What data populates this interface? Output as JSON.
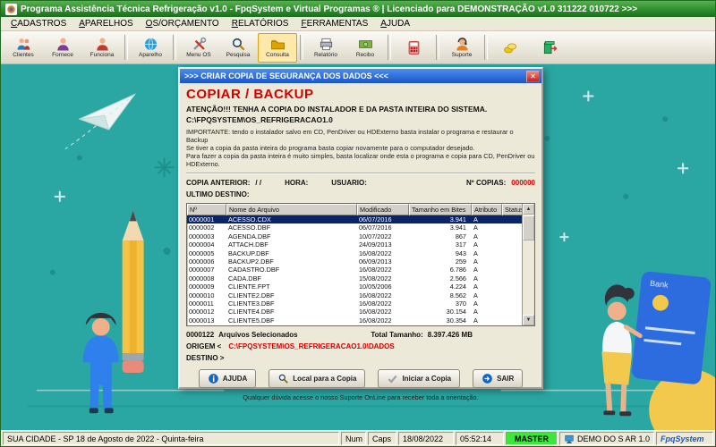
{
  "window": {
    "title": "Programa Assistência Técnica Refrigeração v1.0 - FpqSystem e Virtual Programas ® | Licenciado para  DEMONSTRAÇÃO v1.0 311222 010722 >>>"
  },
  "menu": {
    "items": [
      "CADASTROS",
      "APARELHOS",
      "OS/ORÇAMENTO",
      "RELATÓRIOS",
      "FERRAMENTAS",
      "AJUDA"
    ]
  },
  "toolbar": {
    "buttons": [
      {
        "label": "Clientes",
        "icon": "clients-icon"
      },
      {
        "label": "Fornece",
        "icon": "supplier-icon"
      },
      {
        "label": "Funciona",
        "icon": "employee-icon",
        "sep_after": true
      },
      {
        "label": "Aparelho",
        "icon": "device-globe-icon",
        "sep_after": true
      },
      {
        "label": "Menu OS",
        "icon": "tools-icon"
      },
      {
        "label": "Pesquisa",
        "icon": "search-icon"
      },
      {
        "label": "Consulta",
        "icon": "folder-icon",
        "highlighted": true,
        "sep_after": true
      },
      {
        "label": "Relatório",
        "icon": "printer-icon"
      },
      {
        "label": "Recibo",
        "icon": "money-icon",
        "sep_after": true
      },
      {
        "label": "",
        "icon": "calculator-icon",
        "sep_after": true
      },
      {
        "label": "Suporte",
        "icon": "support-icon",
        "sep_after": true
      },
      {
        "label": "",
        "icon": "coins-icon"
      },
      {
        "label": "",
        "icon": "exit-door-icon"
      }
    ]
  },
  "dialog": {
    "title": ">>> CRIAR COPIA DE SEGURANÇA DOS DADOS <<<",
    "close_glyph": "✕",
    "heading": "COPIAR / BACKUP",
    "warning": "ATENÇÃO!!!  TENHA A COPIA DO  INSTALADOR  E DA PASTA INTEIRA DO  SISTEMA.",
    "system_path": "C:\\FPQSYSTEM\\OS_REFRIGERACAO1.0",
    "important_lines": [
      "IMPORTANTE: tendo o instalador salvo em CD, PenDriver ou HDExterno basta instalar o programa e restaurar o Backup",
      "Se tiver a copia da pasta inteira do programa basta copiar novamente para o computador desejado.",
      "Para fazer a copia da pasta inteira é muito simples, basta localizar onde esta o programa e copia para CD, PenDriver ou HDExterno."
    ],
    "fields": {
      "copia_anterior_label": "COPIA ANTERIOR:",
      "copia_anterior_value": "/ /",
      "hora_label": "HORA:",
      "usuario_label": "USUARIO:",
      "n_copias_label": "Nº COPIAS:",
      "n_copias_value": "000000",
      "ultimo_destino_label": "ULTIMO DESTINO:"
    },
    "table": {
      "columns": [
        "Nº",
        "Nome do Arquivo",
        "Modificado",
        "Tamanho em Bites",
        "Atributo",
        "Status"
      ],
      "selected_index": 0,
      "rows": [
        [
          "0000001",
          "ACESSO.CDX",
          "06/07/2016",
          "3.941",
          "A",
          ""
        ],
        [
          "0000002",
          "ACESSO.DBF",
          "06/07/2016",
          "3.941",
          "A",
          ""
        ],
        [
          "0000003",
          "AGENDA.DBF",
          "10/07/2022",
          "867",
          "A",
          ""
        ],
        [
          "0000004",
          "ATTACH.DBF",
          "24/09/2013",
          "317",
          "A",
          ""
        ],
        [
          "0000005",
          "BACKUP.DBF",
          "16/08/2022",
          "943",
          "A",
          ""
        ],
        [
          "0000006",
          "BACKUP2.DBF",
          "06/09/2013",
          "259",
          "A",
          ""
        ],
        [
          "0000007",
          "CADASTRO.DBF",
          "16/08/2022",
          "6.786",
          "A",
          ""
        ],
        [
          "0000008",
          "CADA.DBF",
          "15/08/2022",
          "2.566",
          "A",
          ""
        ],
        [
          "0000009",
          "CLIENTE.FPT",
          "10/05/2006",
          "4.224",
          "A",
          ""
        ],
        [
          "0000010",
          "CLIENTE2.DBF",
          "16/08/2022",
          "8.562",
          "A",
          ""
        ],
        [
          "0000011",
          "CLIENTE3.DBF",
          "16/08/2022",
          "370",
          "A",
          ""
        ],
        [
          "0000012",
          "CLIENTE4.DBF",
          "16/08/2022",
          "30.154",
          "A",
          ""
        ],
        [
          "0000013",
          "CLIENTE5.DBF",
          "16/08/2022",
          "30.354",
          "A",
          ""
        ]
      ]
    },
    "scrollbar": {
      "up": "▲",
      "down": "▼"
    },
    "summary": {
      "count": "0000122",
      "count_label": "Arquivos Selecionados",
      "total_label": "Total Tamanho:",
      "total_value": "8.397.426 MB"
    },
    "origem_label": "ORIGEM  <",
    "origem_path": "C:\\FPQSYSTEM\\OS_REFRIGERACAO1.0\\DADOS",
    "destino_label": "DESTINO >",
    "buttons": [
      {
        "label": "AJUDA",
        "icon": "help-icon"
      },
      {
        "label": "Local para a Copia",
        "icon": "magnifier-icon"
      },
      {
        "label": "Iniciar a Copia",
        "icon": "check-icon"
      },
      {
        "label": "SAIR",
        "icon": "exit-arrow-icon"
      }
    ],
    "footer_note": "Qualquer dúvida acesse o nosso Suporte OnLine para receber toda a orientação."
  },
  "statusbar": {
    "segments": [
      {
        "kind": "city",
        "text": "SUA CIDADE - SP 18 de Agosto de 2022 - Quinta-feira"
      },
      {
        "kind": "num",
        "text": "Num"
      },
      {
        "kind": "caps",
        "text": "Caps"
      },
      {
        "kind": "date",
        "text": "18/08/2022"
      },
      {
        "kind": "time",
        "text": "05:52:14"
      },
      {
        "kind": "master",
        "text": "MASTER"
      },
      {
        "kind": "demo",
        "text": "DEMO DO S AR 1.0",
        "icon": "monitor-icon"
      },
      {
        "kind": "brand",
        "text": "FpqSystem"
      }
    ]
  },
  "colors": {
    "accent_red": "#d40000",
    "selection_blue": "#0a246a",
    "master_green": "#3ce63c",
    "desktop_teal": "#2aa7a3",
    "titlebar_green": "#2c8a2c",
    "dialog_titlebar_blue": "#1b55c8"
  }
}
